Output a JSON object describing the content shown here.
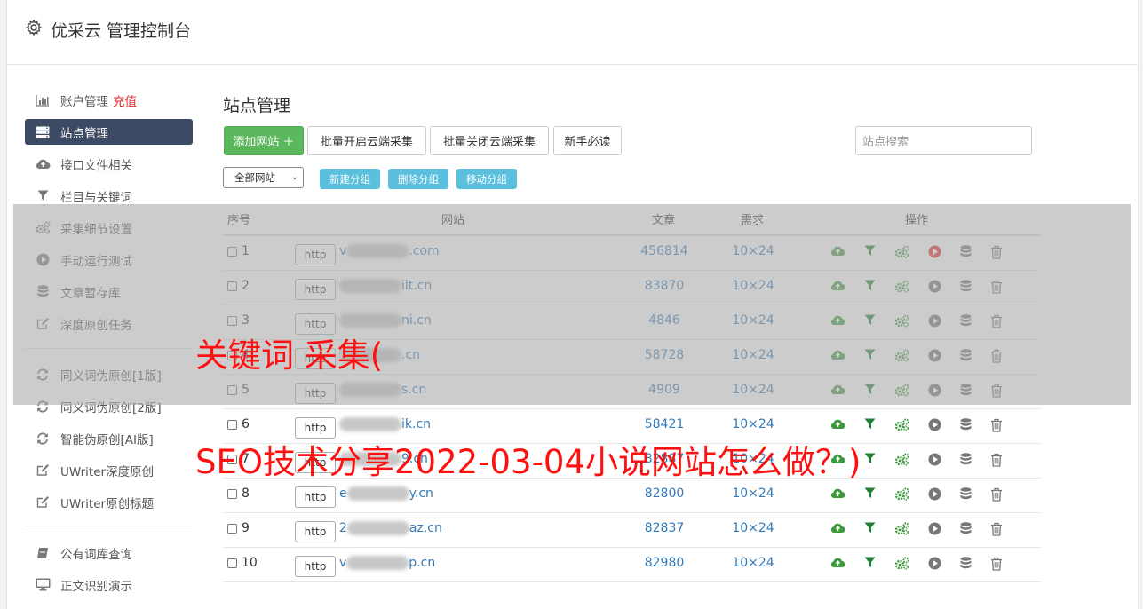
{
  "app": {
    "title": "优采云 管理控制台",
    "icon": "gear-icon"
  },
  "sidebar": {
    "groups": [
      [
        {
          "label": "账户管理",
          "extra": "充值",
          "icon": "bar-chart-icon"
        },
        {
          "label": "站点管理",
          "icon": "server-icon",
          "active": true
        },
        {
          "label": "接口文件相关",
          "icon": "cloud-upload-icon"
        },
        {
          "label": "栏目与关键词",
          "icon": "filter-icon"
        },
        {
          "label": "采集细节设置",
          "icon": "gears-icon"
        },
        {
          "label": "手动运行测试",
          "icon": "play-circle-icon"
        },
        {
          "label": "文章暂存库",
          "icon": "database-icon"
        },
        {
          "label": "深度原创任务",
          "icon": "edit-icon"
        }
      ],
      [
        {
          "label": "同义词伪原创[1版]",
          "icon": "refresh-icon"
        },
        {
          "label": "同义词伪原创[2版]",
          "icon": "refresh-icon"
        },
        {
          "label": "智能伪原创[AI版]",
          "icon": "refresh-icon"
        },
        {
          "label": "UWriter深度原创",
          "icon": "edit-icon"
        },
        {
          "label": "UWriter原创标题",
          "icon": "edit-icon"
        }
      ],
      [
        {
          "label": "公有词库查询",
          "icon": "book-icon"
        },
        {
          "label": "正文识别演示",
          "icon": "monitor-icon"
        }
      ]
    ]
  },
  "main": {
    "title": "站点管理",
    "toolbar": {
      "add_site": "添加网站 ＋",
      "bulk_enable": "批量开启云端采集",
      "bulk_disable": "批量关闭云端采集",
      "newbie": "新手必读",
      "search_placeholder": "站点搜索"
    },
    "filter": {
      "group_select": "全部网站",
      "new_group": "新建分组",
      "delete_group": "删除分组",
      "move_group": "移动分组"
    },
    "table": {
      "headers": {
        "index": "序号",
        "site": "网站",
        "articles": "文章",
        "demand": "需求",
        "actions": "操作"
      },
      "rows": [
        {
          "idx": "1",
          "prefix": "http",
          "site_start": "v",
          "site_end": ".com",
          "articles": "456814",
          "demand": "10×24",
          "play_color": "#e02b2b"
        },
        {
          "idx": "2",
          "prefix": "http",
          "site_start": "",
          "site_end": "ilt.cn",
          "articles": "83870",
          "demand": "10×24",
          "play_color": "#777"
        },
        {
          "idx": "3",
          "prefix": "http",
          "site_start": "",
          "site_end": "ni.cn",
          "articles": "4846",
          "demand": "10×24",
          "play_color": "#777"
        },
        {
          "idx": "4",
          "prefix": "http",
          "site_start": "",
          "site_end": ".cn",
          "articles": "58728",
          "demand": "10×24",
          "play_color": "#777"
        },
        {
          "idx": "5",
          "prefix": "http",
          "site_start": "",
          "site_end": "s.cn",
          "articles": "4909",
          "demand": "10×24",
          "play_color": "#777"
        },
        {
          "idx": "6",
          "prefix": "http",
          "site_start": "",
          "site_end": "ik.cn",
          "articles": "58421",
          "demand": "10×24",
          "play_color": "#777"
        },
        {
          "idx": "7",
          "prefix": "http",
          "site_start": "",
          "site_end": "9.cn",
          "articles": "82887",
          "demand": "10×24",
          "play_color": "#777"
        },
        {
          "idx": "8",
          "prefix": "http",
          "site_start": "e",
          "site_end": "y.cn",
          "articles": "82800",
          "demand": "10×24",
          "play_color": "#777"
        },
        {
          "idx": "9",
          "prefix": "http",
          "site_start": "2",
          "site_end": "az.cn",
          "articles": "82837",
          "demand": "10×24",
          "play_color": "#777"
        },
        {
          "idx": "10",
          "prefix": "http",
          "site_start": "v",
          "site_end": "p.cn",
          "articles": "82980",
          "demand": "10×24",
          "play_color": "#777"
        }
      ]
    }
  },
  "watermark": {
    "line1": "关键词 采集(",
    "line2": "SEO技术分享2022-03-04小说网站怎么做？)"
  },
  "colors": {
    "active_bg": "#3d4a63",
    "green": "#5cb85c",
    "info": "#5bc0de",
    "link": "#337ab7",
    "upload_icon": "#3c9a3c",
    "filter_icon": "#1e7e34",
    "watermark": "#ff1010"
  }
}
